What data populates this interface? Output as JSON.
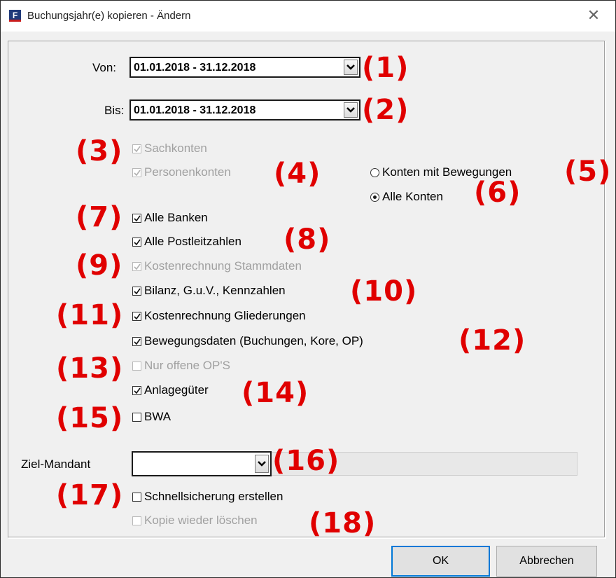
{
  "window": {
    "title": "Buchungsjahr(e) kopieren - Ändern",
    "app_icon_letter": "F"
  },
  "form": {
    "von_label": "Von:",
    "von_value": "01.01.2018 - 31.12.2018",
    "bis_label": "Bis:",
    "bis_value": "01.01.2018 - 31.12.2018",
    "checkboxes": [
      {
        "label": "Sachkonten",
        "checked": true,
        "enabled": false
      },
      {
        "label": "Personenkonten",
        "checked": true,
        "enabled": false
      },
      {
        "label": "Alle Banken",
        "checked": true,
        "enabled": true
      },
      {
        "label": "Alle Postleitzahlen",
        "checked": true,
        "enabled": true
      },
      {
        "label": "Kostenrechnung Stammdaten",
        "checked": true,
        "enabled": false
      },
      {
        "label": "Bilanz, G.u.V., Kennzahlen",
        "checked": true,
        "enabled": true
      },
      {
        "label": "Kostenrechnung Gliederungen",
        "checked": true,
        "enabled": true
      },
      {
        "label": "Bewegungsdaten (Buchungen, Kore, OP)",
        "checked": true,
        "enabled": true
      },
      {
        "label": "Nur offene OP'S",
        "checked": false,
        "enabled": false
      },
      {
        "label": "Anlagegüter",
        "checked": true,
        "enabled": true
      },
      {
        "label": "BWA",
        "checked": false,
        "enabled": true
      }
    ],
    "radios": [
      {
        "label": "Konten mit Bewegungen",
        "selected": false
      },
      {
        "label": "Alle Konten",
        "selected": true
      }
    ],
    "ziel_label": "Ziel-Mandant",
    "ziel_value": "",
    "schnellsicherung_label": "Schnellsicherung erstellen",
    "kopie_label": "Kopie wieder löschen"
  },
  "buttons": {
    "ok": "OK",
    "cancel": "Abbrechen"
  },
  "annotations": [
    "(1)",
    "(2)",
    "(3)",
    "(4)",
    "(5)",
    "(6)",
    "(7)",
    "(8)",
    "(9)",
    "(10)",
    "(11)",
    "(12)",
    "(13)",
    "(14)",
    "(15)",
    "(16)",
    "(17)",
    "(18)"
  ],
  "colors": {
    "annotation": "#e00000",
    "default_button_border": "#0078d7",
    "disabled_text": "#a0a0a0"
  }
}
